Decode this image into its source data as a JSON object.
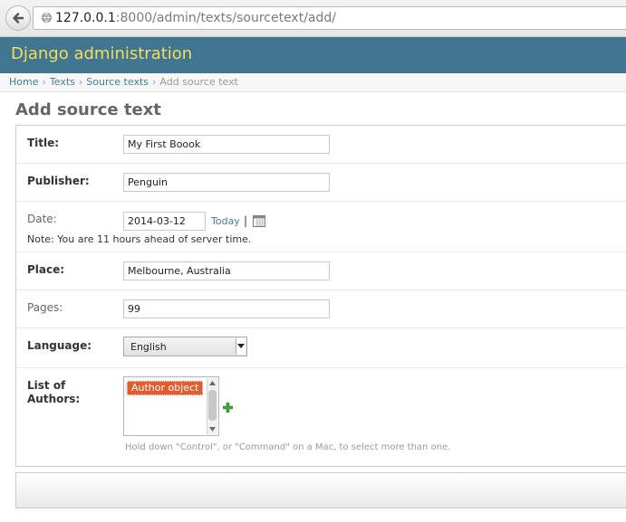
{
  "browser": {
    "url_host": "127.0.0.1",
    "url_rest": ":8000/admin/texts/sourcetext/add/"
  },
  "header": {
    "title": "Django administration"
  },
  "breadcrumbs": {
    "items": [
      "Home",
      "Texts",
      "Source texts"
    ],
    "separator": "›",
    "current": "Add source text"
  },
  "page": {
    "title": "Add source text"
  },
  "form": {
    "title": {
      "label": "Title:",
      "value": "My First Boook"
    },
    "publisher": {
      "label": "Publisher:",
      "value": "Penguin"
    },
    "date": {
      "label": "Date:",
      "value": "2014-03-12",
      "today_link": "Today",
      "separator": "|",
      "note": "Note: You are 11 hours ahead of server time."
    },
    "place": {
      "label": "Place:",
      "value": "Melbourne, Australia"
    },
    "pages": {
      "label": "Pages:",
      "value": "99"
    },
    "language": {
      "label": "Language:",
      "selected": "English"
    },
    "authors": {
      "label_line1": "List of",
      "label_line2": "Authors:",
      "options": [
        "Author object"
      ],
      "help": "Hold down \"Control\", or \"Command\" on a Mac, to select more than one."
    }
  },
  "colors": {
    "header_bg": "#417690",
    "header_title": "#f5dd5d",
    "link": "#447e9b",
    "selected_option": "#e25d2d",
    "add_icon": "#3fa53f"
  }
}
